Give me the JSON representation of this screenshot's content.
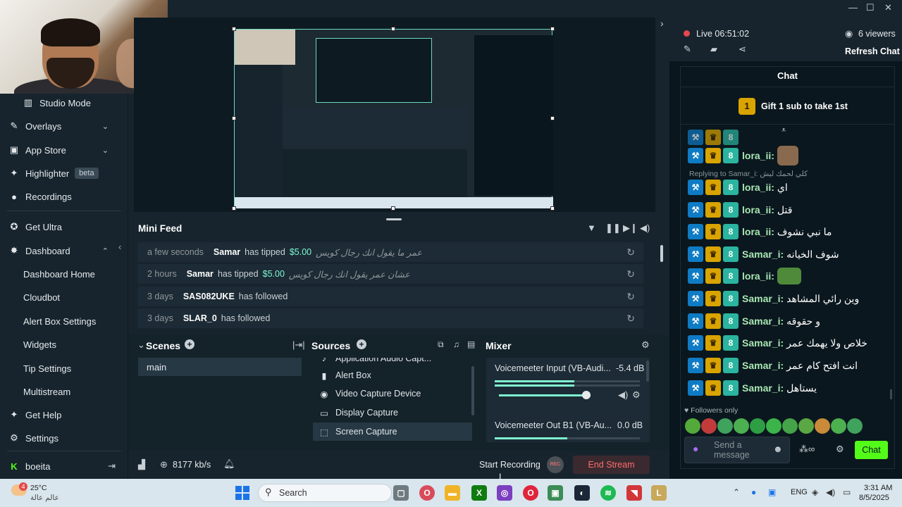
{
  "window": {
    "minimize": "—",
    "maximize": "☐",
    "close": "✕"
  },
  "sidebar": {
    "items": [
      {
        "label": "Studio Mode",
        "icon": "studio-mode-icon",
        "glyph": "▥"
      },
      {
        "label": "Overlays",
        "icon": "overlays-icon",
        "glyph": "✎"
      },
      {
        "label": "App Store",
        "icon": "app-store-icon",
        "glyph": "▣"
      },
      {
        "label": "Highlighter",
        "icon": "highlighter-icon",
        "glyph": "✦",
        "badge": "beta"
      },
      {
        "label": "Recordings",
        "icon": "recordings-icon",
        "glyph": "●"
      },
      {
        "label": "Get Ultra",
        "icon": "ultra-icon",
        "glyph": "✪"
      },
      {
        "label": "Dashboard",
        "icon": "dashboard-icon",
        "glyph": "✸"
      },
      {
        "label": "Dashboard Home"
      },
      {
        "label": "Cloudbot"
      },
      {
        "label": "Alert Box Settings"
      },
      {
        "label": "Widgets"
      },
      {
        "label": "Tip Settings"
      },
      {
        "label": "Multistream"
      },
      {
        "label": "Get Help",
        "icon": "help-icon",
        "glyph": "✦"
      },
      {
        "label": "Settings",
        "icon": "settings-icon",
        "glyph": "⚙"
      }
    ],
    "user": {
      "name": "boeita",
      "logo": "K"
    }
  },
  "minifeed": {
    "title": "Mini Feed",
    "rows": [
      {
        "time": "a few seconds",
        "user": "Samar",
        "action": "has tipped",
        "amount": "$5.00",
        "message": "عمر ما يقول انك رجال كويس"
      },
      {
        "time": "2 hours",
        "user": "Samar",
        "action": "has tipped",
        "amount": "$5.00",
        "message": "عشان عمر يقول انك رجال كويس"
      },
      {
        "time": "3 days",
        "user": "SAS082UKE",
        "action": "has followed",
        "amount": "",
        "message": ""
      },
      {
        "time": "3 days",
        "user": "SLAR_0",
        "action": "has followed",
        "amount": "",
        "message": ""
      }
    ]
  },
  "scenes": {
    "title": "Scenes",
    "items": [
      "main"
    ]
  },
  "sources": {
    "title": "Sources",
    "items": [
      {
        "label": "Application Audio Capt...",
        "glyph": "♪"
      },
      {
        "label": "Alert Box",
        "glyph": "▮"
      },
      {
        "label": "Video Capture Device",
        "glyph": "◉"
      },
      {
        "label": "Display Capture",
        "glyph": "▭"
      },
      {
        "label": "Screen Capture",
        "glyph": "⬚"
      }
    ]
  },
  "mixer": {
    "title": "Mixer",
    "channels": [
      {
        "name": "Voicemeeter Input (VB-Audi...",
        "db": "-5.4 dB",
        "level": 0.55,
        "volume": 0.92
      },
      {
        "name": "Voicemeeter Out B1 (VB-Au...",
        "db": "0.0 dB",
        "level": 0.5,
        "volume": 1.0
      }
    ]
  },
  "statusbar": {
    "bitrate": "8177 kb/s",
    "start_recording": "Start Recording",
    "rec": "REC",
    "end_stream": "End Stream"
  },
  "stream": {
    "live_label": "Live",
    "duration": "06:51:02",
    "viewers": "6 viewers",
    "refresh": "Refresh Chat"
  },
  "chat": {
    "title": "Chat",
    "gift_rank": "1",
    "gift_text": "Gift 1 sub to take 1st",
    "reply_label": "Replying to Samar_i: كلي لحمك ليش",
    "messages": [
      {
        "user": "lora_ii:",
        "text": ""
      },
      {
        "user": "lora_ii:",
        "text": "اي"
      },
      {
        "user": "lora_ii:",
        "text": "قتل"
      },
      {
        "user": "lora_ii:",
        "text": "ما نبي نشوف"
      },
      {
        "user": "Samar_i:",
        "text": "شوف الخيانه"
      },
      {
        "user": "lora_ii:",
        "text": ""
      },
      {
        "user": "Samar_i:",
        "text": "وين رائي المشاهد"
      },
      {
        "user": "Samar_i:",
        "text": "و حقوقه"
      },
      {
        "user": "Samar_i:",
        "text": "خلاص ولا يهمك عمر"
      },
      {
        "user": "Samar_i:",
        "text": "انت افتح كام عمر"
      },
      {
        "user": "Samar_i:",
        "text": "يستاهل"
      }
    ],
    "followers_only": "Followers only",
    "input_placeholder": "Send a message",
    "chat_button": "Chat",
    "badge_sub": "8"
  },
  "taskbar": {
    "weather_temp": "25°C",
    "weather_desc": "عالم عالة",
    "weather_badge": "4",
    "search": "Search",
    "lang": "ENG",
    "time": "3:31 AM",
    "date": "8/5/2025"
  },
  "colors": {
    "accent": "#80f5d2",
    "end_stream": "#ff6b6b",
    "chat_button": "#53fc18",
    "username": "#a9e7b4"
  }
}
